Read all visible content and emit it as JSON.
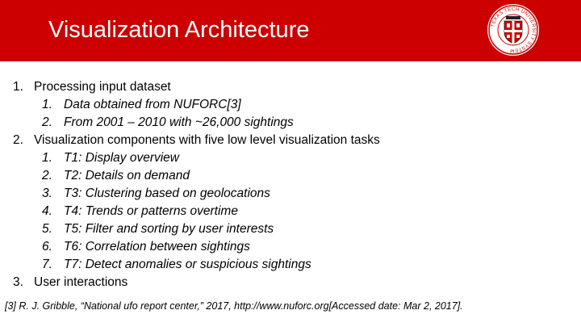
{
  "slide": {
    "title": "Visualization Architecture",
    "header_color": "#cc0000",
    "logo": {
      "icon": "university-seal-icon",
      "ring_text": "TEXAS TECH UNIVERSITY SYSTEM"
    },
    "items": [
      {
        "num": "1.",
        "text": "Processing input dataset",
        "sub": [
          {
            "num": "1.",
            "text": "Data obtained from NUFORC[3]"
          },
          {
            "num": "2.",
            "text": "From 2001 – 2010 with ~26,000 sightings"
          }
        ]
      },
      {
        "num": "2.",
        "text": "Visualization components with five low level visualization tasks",
        "sub": [
          {
            "num": "1.",
            "text": "T1: Display overview"
          },
          {
            "num": "2.",
            "text": "T2: Details on demand"
          },
          {
            "num": "3.",
            "text": "T3: Clustering based on geolocations"
          },
          {
            "num": "4.",
            "text": "T4: Trends or patterns overtime"
          },
          {
            "num": "5.",
            "text": "T5: Filter and sorting by user interests"
          },
          {
            "num": "6.",
            "text": "T6: Correlation between sightings"
          },
          {
            "num": "7.",
            "text": "T7: Detect anomalies or suspicious sightings"
          }
        ]
      },
      {
        "num": "3.",
        "text": "User interactions",
        "sub": []
      }
    ],
    "footnote": "[3]  R. J. Gribble, “National ufo report center,” 2017, http://www.nuforc.org[Accessed date: Mar 2, 2017]."
  }
}
